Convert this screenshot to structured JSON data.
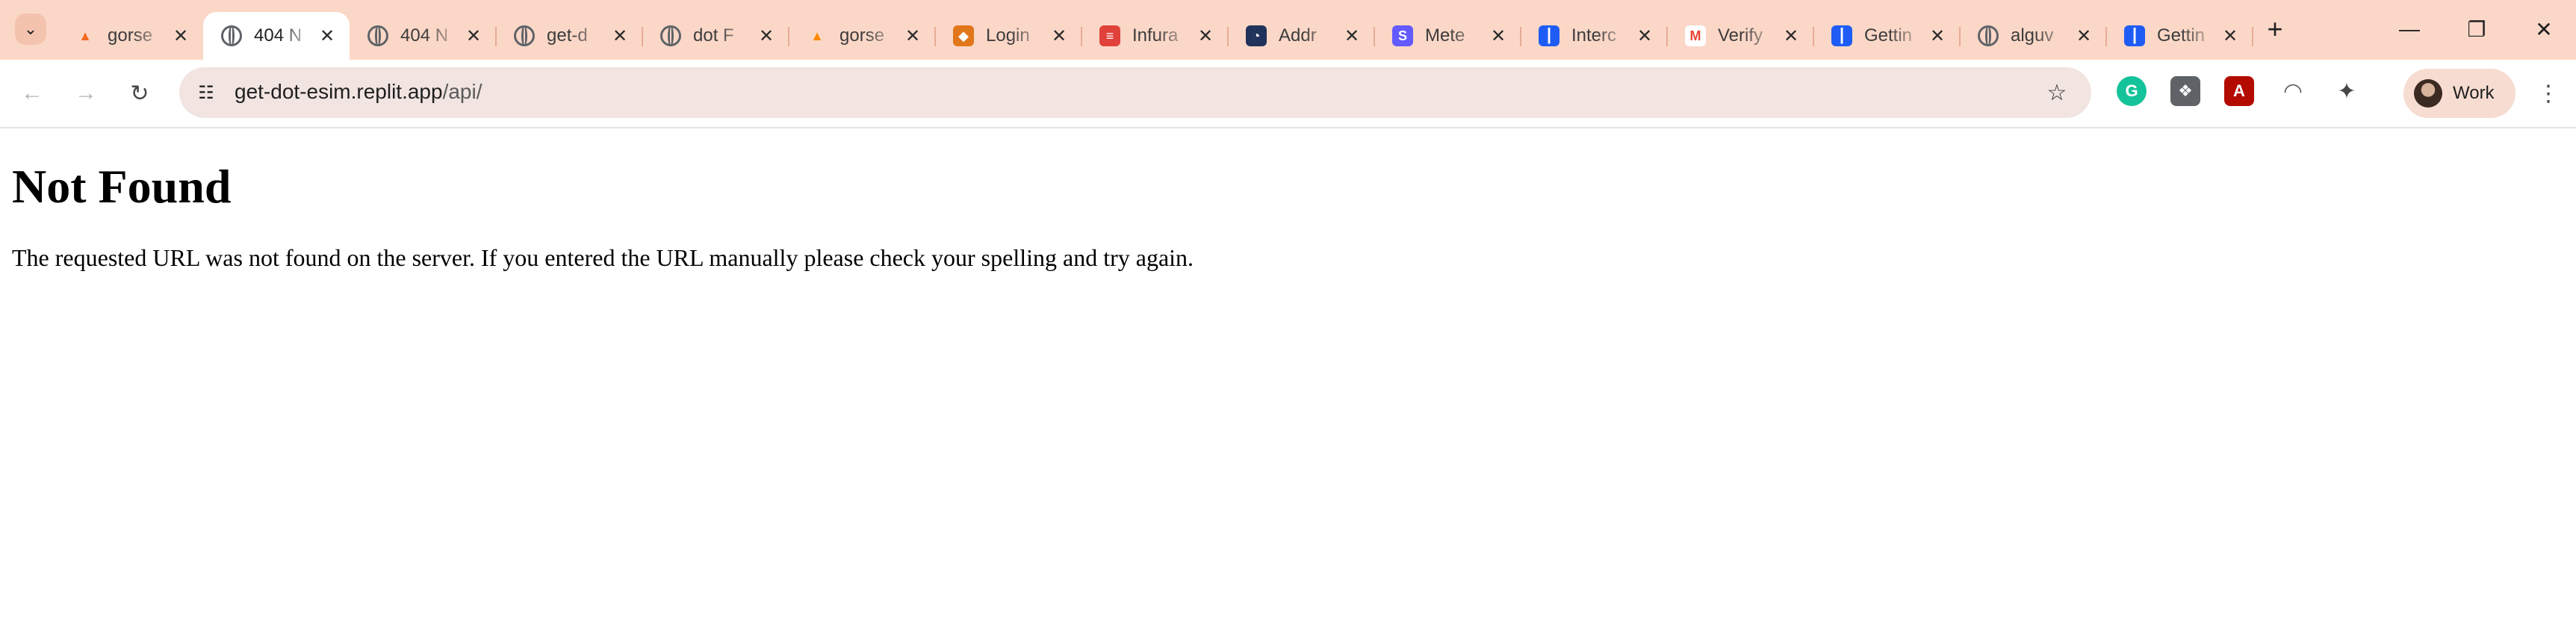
{
  "tabs": [
    {
      "title": "gorse",
      "icon": "gorse-logo-icon",
      "icon_color": "#f26b21",
      "active": false
    },
    {
      "title": "404 N",
      "icon": "globe-icon",
      "icon_color": "#5f6368",
      "active": true
    },
    {
      "title": "404 N",
      "icon": "globe-icon",
      "icon_color": "#5f6368",
      "active": false
    },
    {
      "title": "get-d",
      "icon": "globe-icon",
      "icon_color": "#5f6368",
      "active": false
    },
    {
      "title": "dot F",
      "icon": "globe-icon",
      "icon_color": "#5f6368",
      "active": false
    },
    {
      "title": "gorse",
      "icon": "firebase-flame-icon",
      "icon_color": "#ff8a00",
      "active": false
    },
    {
      "title": "Login",
      "icon": "metamask-fox-icon",
      "icon_color": "#e2761b",
      "active": false
    },
    {
      "title": "Infura",
      "icon": "infura-logo-icon",
      "icon_color": "#e0413a",
      "active": false
    },
    {
      "title": "Addr",
      "icon": "etherscan-logo-icon",
      "icon_color": "#21325b",
      "active": false
    },
    {
      "title": "Mete",
      "icon": "stripe-s-icon",
      "icon_color": "#635bff",
      "active": false
    },
    {
      "title": "Interc",
      "icon": "intercom-logo-icon",
      "icon_color": "#1f5cf5",
      "active": false
    },
    {
      "title": "Verify",
      "icon": "gmail-logo-icon",
      "icon_color": "#ea4335",
      "active": false
    },
    {
      "title": "Gettin",
      "icon": "intercom-logo-icon",
      "icon_color": "#1f5cf5",
      "active": false
    },
    {
      "title": "alguv",
      "icon": "globe-icon",
      "icon_color": "#5f6368",
      "active": false
    },
    {
      "title": "Gettin",
      "icon": "intercom-logo-icon",
      "icon_color": "#1f5cf5",
      "active": false
    }
  ],
  "omnibox": {
    "url_host": "get-dot-esim.replit.app",
    "url_path": "/api/"
  },
  "extensions": [
    {
      "name": "grammarly-icon",
      "color": "#15c39a"
    },
    {
      "name": "extension-puzzle-grey-icon",
      "color": "#5f6368"
    },
    {
      "name": "adobe-acrobat-icon",
      "color": "#b30b00"
    },
    {
      "name": "arc-extension-icon",
      "color": "#5f6368"
    },
    {
      "name": "extensions-icon",
      "color": "#474747"
    }
  ],
  "profile": {
    "label": "Work"
  },
  "page": {
    "heading": "Not Found",
    "message": "The requested URL was not found on the server. If you entered the URL manually please check your spelling and try again."
  },
  "colors": {
    "tab_strip": "#fbd7c7",
    "omnibox": "#f1e4e1"
  }
}
